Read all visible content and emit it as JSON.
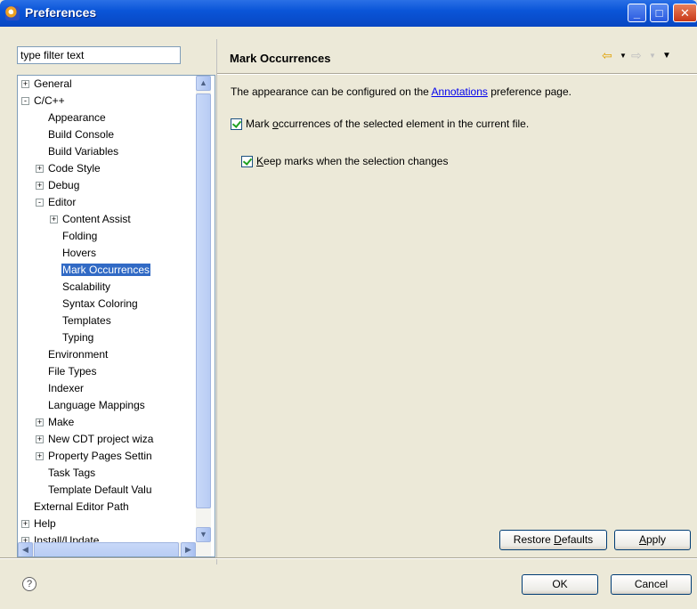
{
  "window": {
    "title": "Preferences"
  },
  "filter": {
    "placeholder": "type filter text"
  },
  "tree": [
    {
      "label": "General",
      "level": 0,
      "toggle": "+"
    },
    {
      "label": "C/C++",
      "level": 0,
      "toggle": "-"
    },
    {
      "label": "Appearance",
      "level": 1,
      "toggle": ""
    },
    {
      "label": "Build Console",
      "level": 1,
      "toggle": ""
    },
    {
      "label": "Build Variables",
      "level": 1,
      "toggle": ""
    },
    {
      "label": "Code Style",
      "level": 1,
      "toggle": "+"
    },
    {
      "label": "Debug",
      "level": 1,
      "toggle": "+"
    },
    {
      "label": "Editor",
      "level": 1,
      "toggle": "-"
    },
    {
      "label": "Content Assist",
      "level": 2,
      "toggle": "+"
    },
    {
      "label": "Folding",
      "level": 2,
      "toggle": ""
    },
    {
      "label": "Hovers",
      "level": 2,
      "toggle": ""
    },
    {
      "label": "Mark Occurrences",
      "level": 2,
      "toggle": "",
      "selected": true
    },
    {
      "label": "Scalability",
      "level": 2,
      "toggle": ""
    },
    {
      "label": "Syntax Coloring",
      "level": 2,
      "toggle": ""
    },
    {
      "label": "Templates",
      "level": 2,
      "toggle": ""
    },
    {
      "label": "Typing",
      "level": 2,
      "toggle": ""
    },
    {
      "label": "Environment",
      "level": 1,
      "toggle": ""
    },
    {
      "label": "File Types",
      "level": 1,
      "toggle": ""
    },
    {
      "label": "Indexer",
      "level": 1,
      "toggle": ""
    },
    {
      "label": "Language Mappings",
      "level": 1,
      "toggle": ""
    },
    {
      "label": "Make",
      "level": 1,
      "toggle": "+"
    },
    {
      "label": "New CDT project wiza",
      "level": 1,
      "toggle": "+"
    },
    {
      "label": "Property Pages Settin",
      "level": 1,
      "toggle": "+"
    },
    {
      "label": "Task Tags",
      "level": 1,
      "toggle": ""
    },
    {
      "label": "Template Default Valu",
      "level": 1,
      "toggle": ""
    },
    {
      "label": "External Editor Path",
      "level": 0,
      "toggle": ""
    },
    {
      "label": "Help",
      "level": 0,
      "toggle": "+"
    },
    {
      "label": "Install/Update",
      "level": 0,
      "toggle": "+"
    }
  ],
  "page": {
    "title": "Mark Occurrences",
    "desc_prefix": "The appearance can be configured on the ",
    "desc_link": "Annotations",
    "desc_suffix": " preference page.",
    "check1_pre": "Mark ",
    "check1_mn": "o",
    "check1_post": "ccurrences of the selected element in the current file.",
    "check1_checked": true,
    "check2_mn": "K",
    "check2_post": "eep marks when the selection changes",
    "check2_checked": true
  },
  "buttons": {
    "restore_pre": "Restore ",
    "restore_mn": "D",
    "restore_post": "efaults",
    "apply_mn": "A",
    "apply_post": "pply",
    "ok": "OK",
    "cancel": "Cancel"
  },
  "icons": {
    "back": "back-arrow-icon",
    "forward": "forward-arrow-icon",
    "menu": "view-menu-icon",
    "help": "help-icon"
  }
}
